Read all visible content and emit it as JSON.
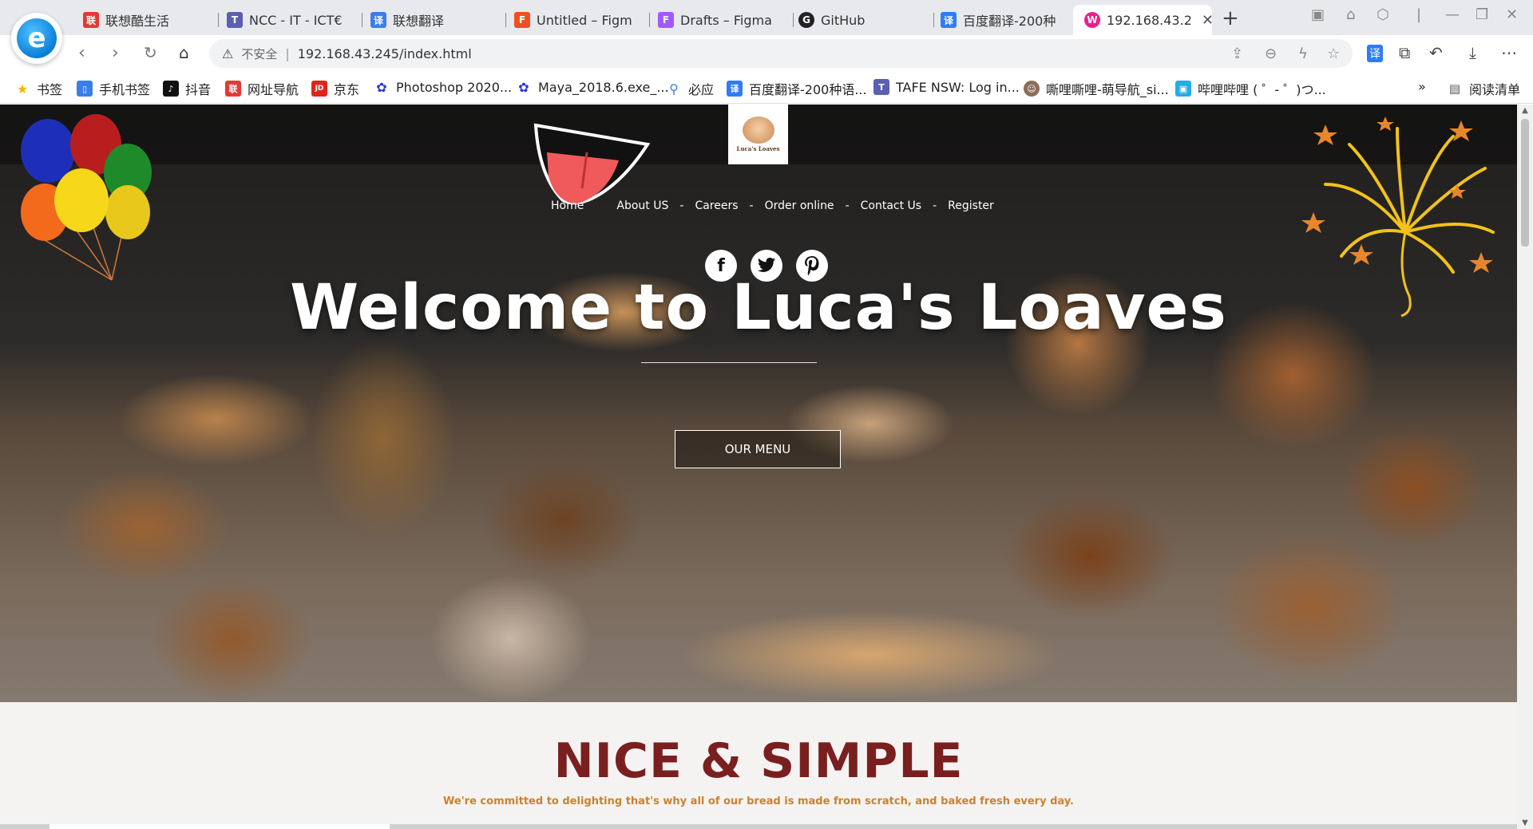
{
  "browser": {
    "tabs": [
      {
        "title": "联想酷生活",
        "icon_color": "#e53935",
        "icon_char": "联"
      },
      {
        "title": "NCC - IT - ICT€",
        "icon_color": "#5b5fb0",
        "icon_char": "T"
      },
      {
        "title": "联想翻译",
        "icon_color": "#3b7ee8",
        "icon_char": "译"
      },
      {
        "title": "Untitled – Figm",
        "icon_color": "#f24e1e",
        "icon_char": "F"
      },
      {
        "title": "Drafts – Figma",
        "icon_color": "#a259ff",
        "icon_char": "F"
      },
      {
        "title": "GitHub",
        "icon_color": "#222222",
        "icon_char": "G"
      },
      {
        "title": "百度翻译-200种",
        "icon_color": "#2e7cf6",
        "icon_char": "译"
      },
      {
        "title": "192.168.43.2",
        "icon_color": "#e91e8c",
        "icon_char": "W"
      }
    ],
    "active_tab": "192.168.43.2",
    "address": {
      "insecure_label": "不安全",
      "url": "192.168.43.245/index.html"
    },
    "reading_list": "阅读清单",
    "more_bookmarks": "»"
  },
  "bookmarks": [
    {
      "label": "书签",
      "icon_color": "#f5b400",
      "icon_char": "★"
    },
    {
      "label": "手机书签",
      "icon_color": "#3b7ee8",
      "icon_char": "▯"
    },
    {
      "label": "抖音",
      "icon_color": "#111111",
      "icon_char": "♪"
    },
    {
      "label": "网址导航",
      "icon_color": "#e53935",
      "icon_char": "联"
    },
    {
      "label": "京东",
      "icon_color": "#e1251b",
      "icon_char": "JD"
    },
    {
      "label": "Photoshop 2020...",
      "icon_color": "#2932e1",
      "icon_char": "✿"
    },
    {
      "label": "Maya_2018.6.exe_...",
      "icon_color": "#2932e1",
      "icon_char": "✿"
    },
    {
      "label": "必应",
      "icon_color": "#3b7ee8",
      "icon_char": "⚲"
    },
    {
      "label": "百度翻译-200种语...",
      "icon_color": "#2e7cf6",
      "icon_char": "译"
    },
    {
      "label": "TAFE NSW: Log in...",
      "icon_color": "#5b5fb0",
      "icon_char": "T"
    },
    {
      "label": "嘶哩嘶哩-萌导航_si...",
      "icon_color": "#8a6d5a",
      "icon_char": "☺"
    },
    {
      "label": "哔哩哔哩 ( ゜- ゜)つ...",
      "icon_color": "#23ade5",
      "icon_char": "▣"
    }
  ],
  "site": {
    "nav": [
      {
        "label": "Home"
      },
      {
        "label": "About US"
      },
      {
        "label": "Careers"
      },
      {
        "label": "Order online"
      },
      {
        "label": "Contact Us"
      },
      {
        "label": "Register"
      }
    ],
    "nav_separator": "-",
    "social": [
      {
        "name": "facebook",
        "glyph": "f"
      },
      {
        "name": "twitter",
        "glyph": "t"
      },
      {
        "name": "pinterest",
        "glyph": "p"
      }
    ],
    "logo_text": "Luca's Loaves",
    "hero_title": "Welcome to Luca's Loaves",
    "hero_button": "OUR MENU",
    "section_title": "NICE & SIMPLE",
    "section_subtitle": "We're committed to delighting that's why all of our bread is made from scratch, and baked fresh every day.",
    "colors": {
      "section_title": "#7a1f1f",
      "section_subtitle": "#c9822f",
      "mouth_red": "#f05a5a"
    }
  }
}
